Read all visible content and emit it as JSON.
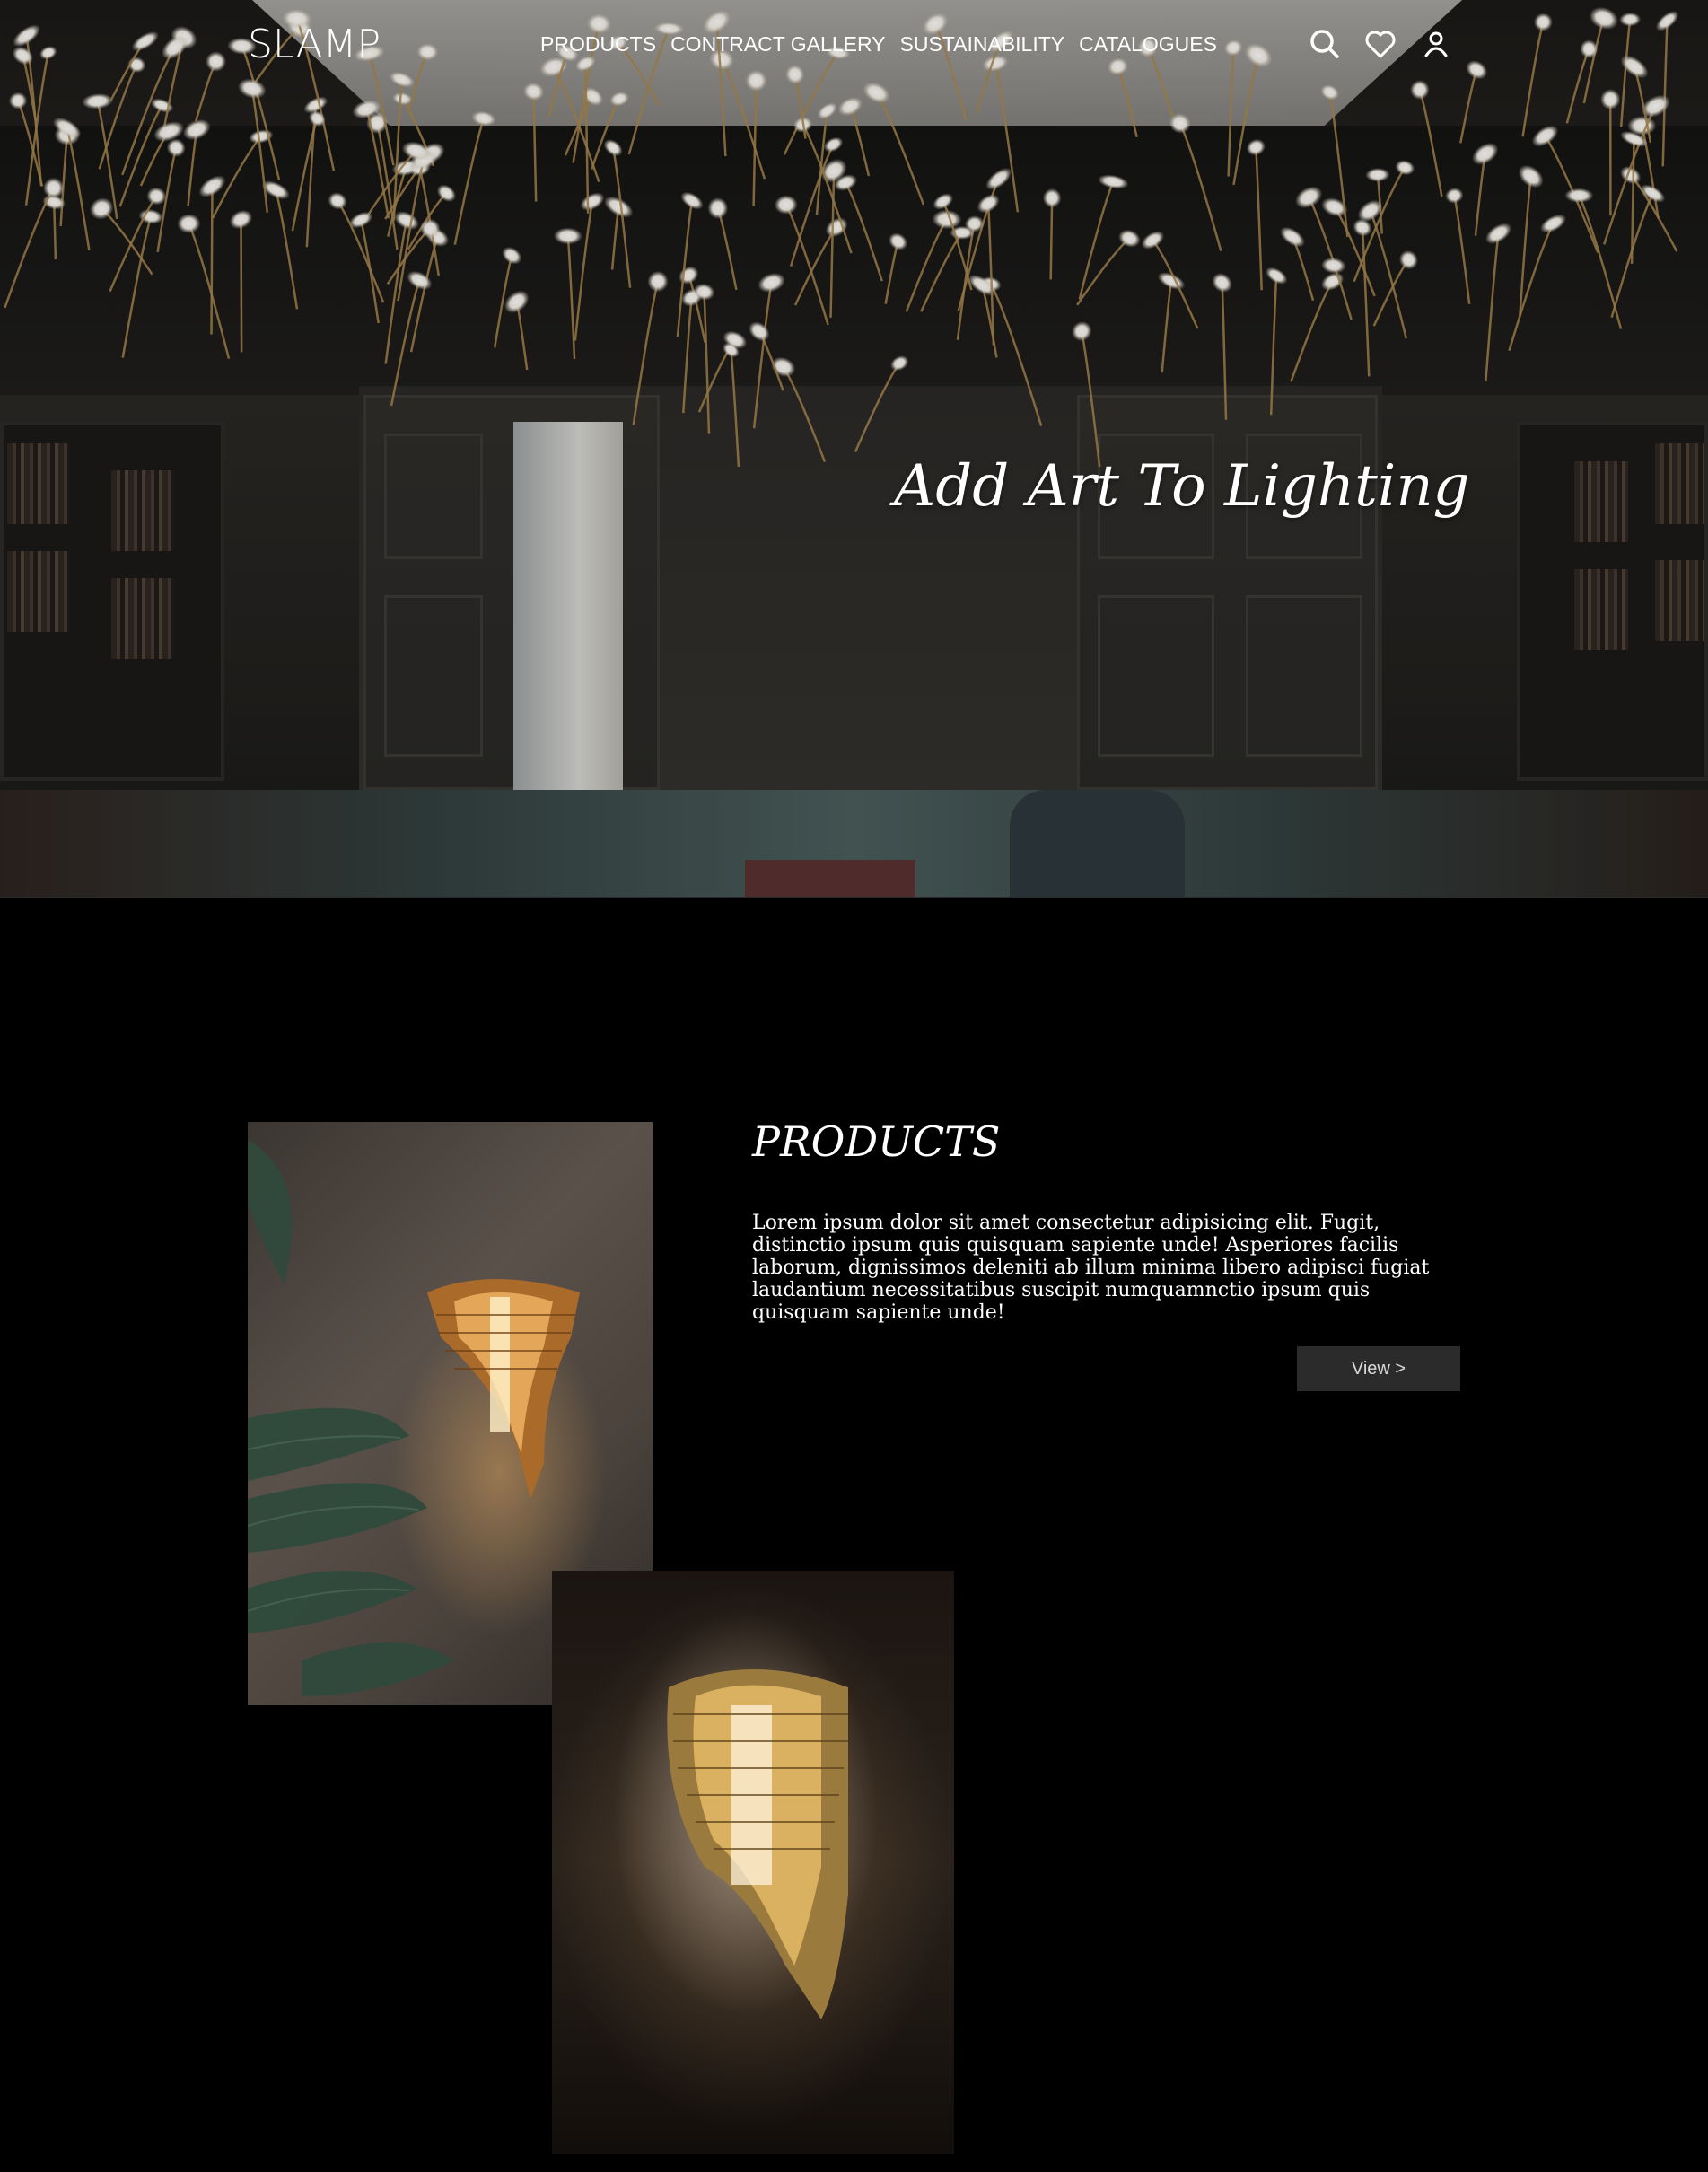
{
  "brand": {
    "logo": "SLAMP"
  },
  "nav": {
    "items": [
      {
        "label": "PRODUCTS"
      },
      {
        "label": "CONTRACT GALLERY"
      },
      {
        "label": "SUSTAINABILITY"
      },
      {
        "label": "CATALOGUES"
      }
    ],
    "icons": [
      "search-icon",
      "heart-icon",
      "user-icon"
    ]
  },
  "hero": {
    "tagline": "Add Art To Lighting"
  },
  "products": {
    "title": "PRODUCTS",
    "text": "Lorem ipsum dolor sit amet consectetur adipisicing elit. Fugit, distinctio ipsum quis quisquam sapiente unde! Asperiores facilis laborum, dignissimos deleniti ab illum minima libero adipisci fugiat laudantium necessitatibus suscipit numquamnctio ipsum quis quisquam sapiente unde!",
    "button_label": "View >"
  },
  "colors": {
    "background": "#000000",
    "button_bg": "#2b2b2b",
    "text": "#ffffff"
  }
}
